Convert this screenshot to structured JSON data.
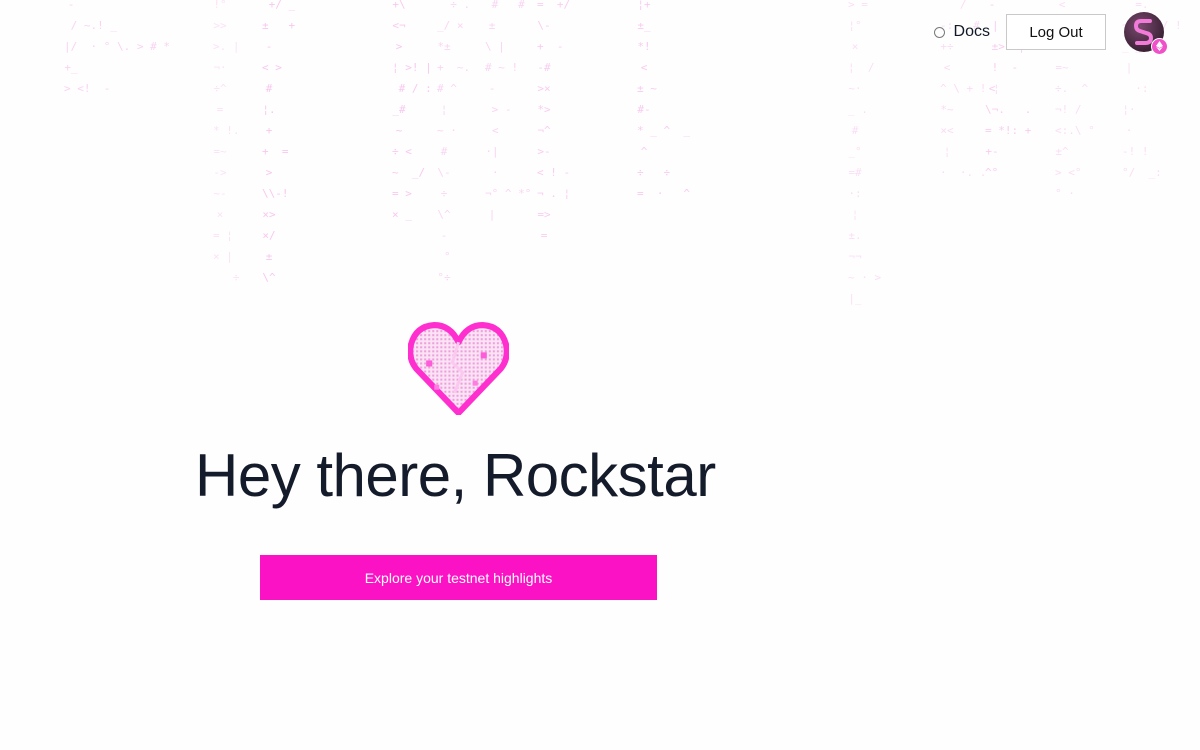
{
  "header": {
    "docs_label": "Docs",
    "logout_label": "Log Out"
  },
  "avatar": {
    "icon": "user-avatar-icon",
    "badge_icon": "ethereum-icon"
  },
  "hero": {
    "heart_icon": "pixel-heart-icon",
    "title": "Hey there, Rockstar",
    "cta_label": "Explore your testnet highlights"
  },
  "colors": {
    "accent": "#fb12c4",
    "title": "#141b2b",
    "rain": "#f06ad6"
  }
}
